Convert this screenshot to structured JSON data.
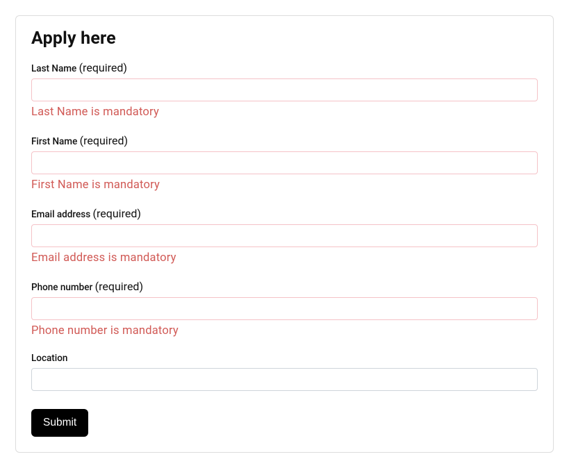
{
  "form": {
    "title": "Apply here",
    "fields": {
      "last_name": {
        "label": "Last Name",
        "hint": "(required)",
        "value": "",
        "error": "Last Name is mandatory",
        "invalid": true
      },
      "first_name": {
        "label": "First Name",
        "hint": "(required)",
        "value": "",
        "error": "First Name is mandatory",
        "invalid": true
      },
      "email": {
        "label": "Email address",
        "hint": "(required)",
        "value": "",
        "error": "Email address is mandatory",
        "invalid": true
      },
      "phone": {
        "label": "Phone number",
        "hint": "(required)",
        "value": "",
        "error": "Phone number is mandatory",
        "invalid": true
      },
      "location": {
        "label": "Location",
        "hint": "",
        "value": "",
        "error": "",
        "invalid": false
      }
    },
    "submit_label": "Submit"
  }
}
